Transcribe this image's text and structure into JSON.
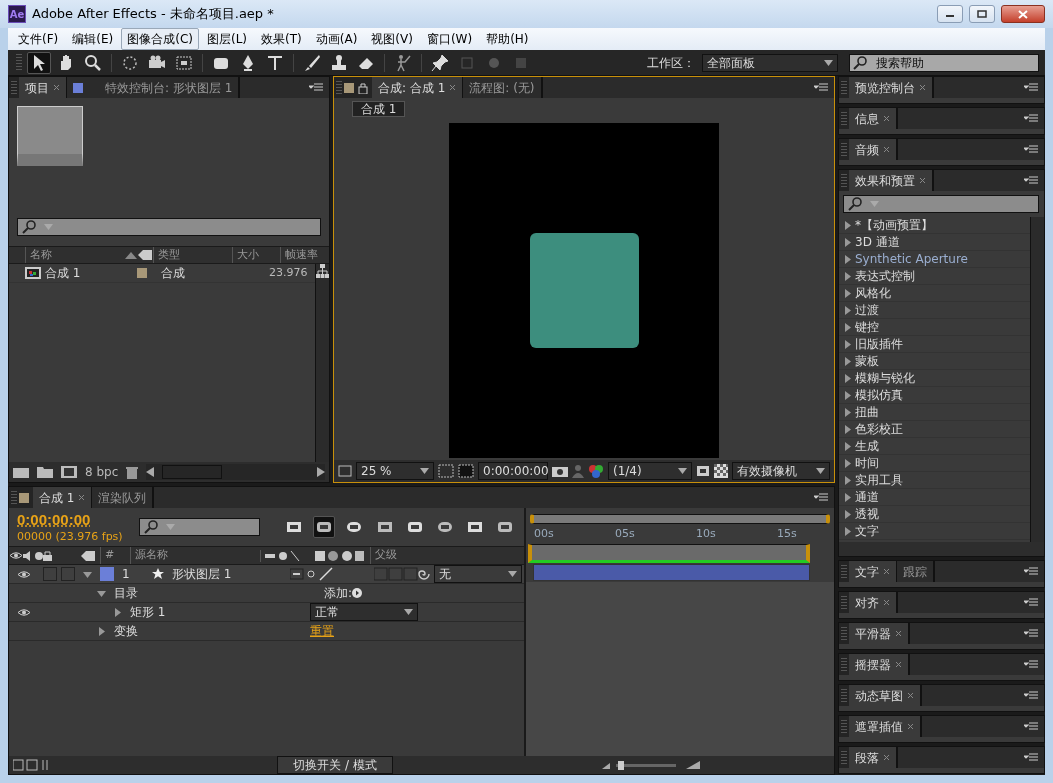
{
  "window": {
    "app_icon": "Ae",
    "title": "Adobe After Effects - 未命名项目.aep *"
  },
  "menu": [
    {
      "label": "文件(F)",
      "selected": false
    },
    {
      "label": "编辑(E)",
      "selected": false
    },
    {
      "label": "图像合成(C)",
      "selected": true
    },
    {
      "label": "图层(L)",
      "selected": false
    },
    {
      "label": "效果(T)",
      "selected": false
    },
    {
      "label": "动画(A)",
      "selected": false
    },
    {
      "label": "视图(V)",
      "selected": false
    },
    {
      "label": "窗口(W)",
      "selected": false
    },
    {
      "label": "帮助(H)",
      "selected": false
    }
  ],
  "toolbar": {
    "workspace_label": "工作区：",
    "workspace": "全部面板",
    "search": {
      "placeholder": "搜索帮助"
    }
  },
  "project_panel": {
    "tabs": [
      {
        "label": "项目",
        "selected": true
      },
      {
        "label": "特效控制台: 形状图层 1",
        "selected": false
      }
    ],
    "columns": [
      "名称",
      "类型",
      "大小",
      "帧速率"
    ],
    "rows": [
      {
        "name": "合成 1",
        "type": "合成",
        "frame_rate": "23.976",
        "color": "#a89878"
      }
    ],
    "bit_depth": "8 bpc"
  },
  "viewer": {
    "tabs": [
      {
        "label": "合成: 合成 1",
        "selected": true
      },
      {
        "label": "流程图: (无)",
        "selected": false
      }
    ],
    "breadcrumb": "合成 1",
    "zoom": "25 %",
    "timecode": "0:00:00:00",
    "resolution": "(1/4)",
    "camera": "有效摄像机"
  },
  "timeline": {
    "tabs": [
      {
        "label": "合成 1",
        "selected": true
      },
      {
        "label": "渲染队列",
        "selected": false
      }
    ],
    "timecode": "0:00:00:00",
    "frame_info": "00000 (23.976 fps)",
    "columns": [
      "#",
      "源名称",
      "父级"
    ],
    "ruler": [
      "00s",
      "05s",
      "10s",
      "15s"
    ],
    "layers": [
      {
        "index": "1",
        "name": "形状图层 1",
        "parent": "无",
        "color": "#6b7fd8",
        "visible": true,
        "expanded": true,
        "properties": [
          {
            "label": "目录",
            "expanded": true,
            "action": "添加:",
            "children": [
              {
                "label": "矩形 1",
                "expanded": false,
                "visible": true,
                "mode": "正常"
              }
            ]
          },
          {
            "label": "变换",
            "expanded": false,
            "link": "重置"
          }
        ]
      }
    ],
    "footer": "切换开关 / 模式"
  },
  "right_panels": [
    {
      "tabs": [
        {
          "label": "预览控制台",
          "selected": true
        }
      ]
    },
    {
      "tabs": [
        {
          "label": "信息",
          "selected": true
        }
      ]
    },
    {
      "tabs": [
        {
          "label": "音频",
          "selected": true
        }
      ]
    },
    {
      "kind": "effects",
      "tabs": [
        {
          "label": "效果和预置",
          "selected": true
        }
      ],
      "items": [
        "*【动画预置】",
        "3D 通道",
        "Synthetic Aperture",
        "表达式控制",
        "风格化",
        "过渡",
        "键控",
        "旧版插件",
        "蒙板",
        "模糊与锐化",
        "模拟仿真",
        "扭曲",
        "色彩校正",
        "生成",
        "时间",
        "实用工具",
        "通道",
        "透视",
        "文字"
      ]
    },
    {
      "tabs": [
        {
          "label": "文字",
          "selected": true
        },
        {
          "label": "跟踪",
          "selected": false
        }
      ]
    },
    {
      "tabs": [
        {
          "label": "对齐",
          "selected": true
        }
      ]
    },
    {
      "tabs": [
        {
          "label": "平滑器",
          "selected": true
        }
      ]
    },
    {
      "tabs": [
        {
          "label": "摇摆器",
          "selected": true
        }
      ]
    },
    {
      "tabs": [
        {
          "label": "动态草图",
          "selected": true
        }
      ]
    },
    {
      "tabs": [
        {
          "label": "遮罩插值",
          "selected": true
        }
      ]
    },
    {
      "tabs": [
        {
          "label": "段落",
          "selected": true
        }
      ]
    }
  ]
}
